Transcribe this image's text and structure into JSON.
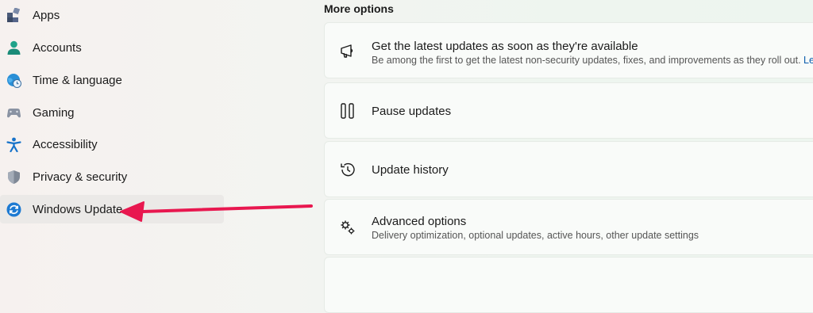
{
  "sidebar": {
    "items": [
      {
        "label": "Apps",
        "icon": "apps-icon"
      },
      {
        "label": "Accounts",
        "icon": "person-icon"
      },
      {
        "label": "Time & language",
        "icon": "globe-clock-icon"
      },
      {
        "label": "Gaming",
        "icon": "controller-icon"
      },
      {
        "label": "Accessibility",
        "icon": "accessibility-icon"
      },
      {
        "label": "Privacy & security",
        "icon": "shield-icon"
      },
      {
        "label": "Windows Update",
        "icon": "sync-icon",
        "active": true
      }
    ]
  },
  "main": {
    "section_title": "More options",
    "cards": [
      {
        "title": "Get the latest updates as soon as they're available",
        "description": "Be among the first to get the latest non-security updates, fixes, and improvements as they roll out.",
        "link": "Le",
        "icon": "megaphone-icon"
      },
      {
        "title": "Pause updates",
        "icon": "pause-icon"
      },
      {
        "title": "Update history",
        "icon": "history-icon"
      },
      {
        "title": "Advanced options",
        "description": "Delivery optimization, optional updates, active hours, other update settings",
        "icon": "gears-icon"
      }
    ]
  },
  "annotation": {
    "type": "arrow",
    "color": "#e8174f"
  }
}
